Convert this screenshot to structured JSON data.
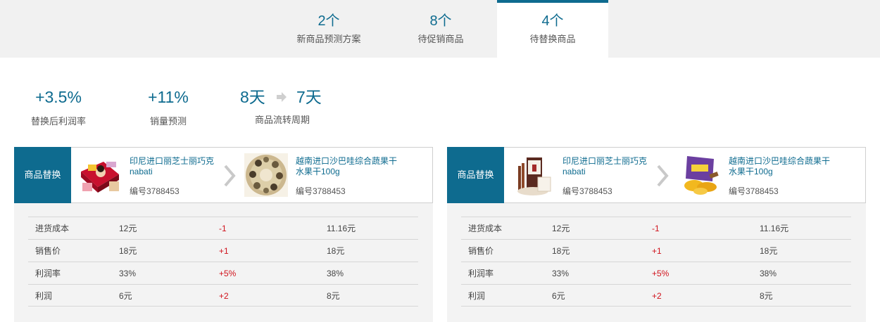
{
  "tabs": [
    {
      "count": "2个",
      "label": "新商品预测方案"
    },
    {
      "count": "8个",
      "label": "待促销商品"
    },
    {
      "count": "4个",
      "label": "待替换商品"
    }
  ],
  "metrics": {
    "profit_rate": {
      "value": "+3.5%",
      "label": "替换后利润率"
    },
    "sales": {
      "value": "+11%",
      "label": "销量预测"
    },
    "cycle": {
      "from": "8天",
      "to": "7天",
      "label": "商品流转周期"
    }
  },
  "cards": [
    {
      "label": "商品替换",
      "from_product": {
        "name": "印尼进口丽芝士丽巧克nabati",
        "code": "编号3788453"
      },
      "to_product": {
        "name": "越南进口沙巴哇综合蔬果干水果干100g",
        "code": "编号3788453"
      },
      "rows": [
        {
          "name": "进货成本",
          "old": "12元",
          "delta": "-1",
          "new": "11.16元"
        },
        {
          "name": "销售价",
          "old": "18元",
          "delta": "+1",
          "new": "18元"
        },
        {
          "name": "利润率",
          "old": "33%",
          "delta": "+5%",
          "new": "38%"
        },
        {
          "name": "利润",
          "old": "6元",
          "delta": "+2",
          "new": "8元"
        }
      ]
    },
    {
      "label": "商品替换",
      "from_product": {
        "name": "印尼进口丽芝士丽巧克nabati",
        "code": "编号3788453"
      },
      "to_product": {
        "name": "越南进口沙巴哇综合蔬果干水果干100g",
        "code": "编号3788453"
      },
      "rows": [
        {
          "name": "进货成本",
          "old": "12元",
          "delta": "-1",
          "new": "11.16元"
        },
        {
          "name": "销售价",
          "old": "18元",
          "delta": "+1",
          "new": "18元"
        },
        {
          "name": "利润率",
          "old": "33%",
          "delta": "+5%",
          "new": "38%"
        },
        {
          "name": "利润",
          "old": "6元",
          "delta": "+2",
          "new": "8元"
        }
      ]
    }
  ],
  "colors": {
    "accent": "#0e6b8f",
    "delta": "#d0121b",
    "tab_bg": "#f1f1f1",
    "table_bg": "#f3f3f3"
  },
  "icons": {
    "arrow": "arrow-right-icon",
    "chevron": "chevron-right-icon"
  }
}
